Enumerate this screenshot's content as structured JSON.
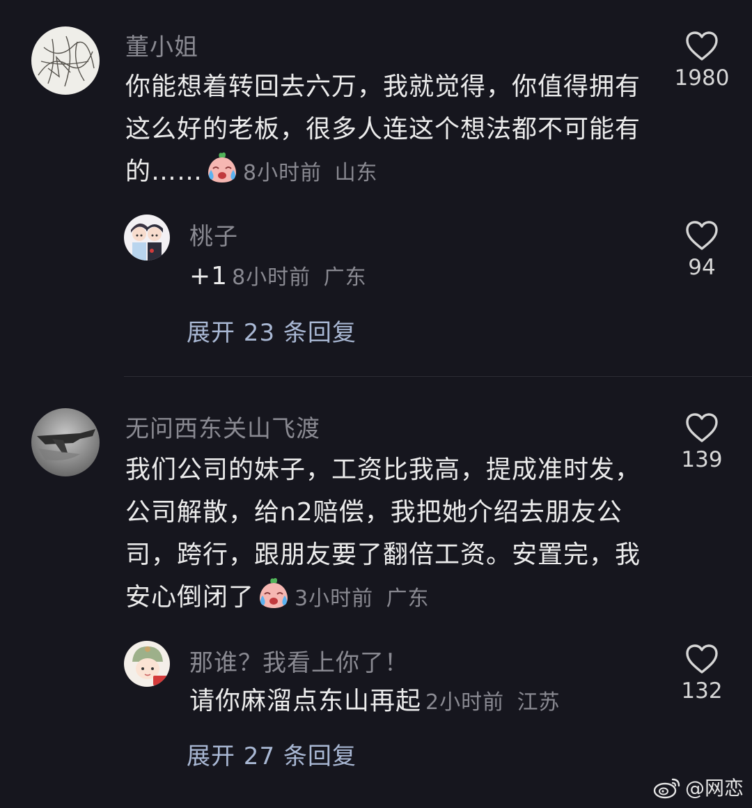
{
  "comments": [
    {
      "username": "董小姐",
      "text": "你能想着转回去六万，我就觉得，你值得拥有这么好的老板，很多人连这个想法都不可能有的……",
      "time": "8小时前",
      "location": "山东",
      "likes": "1980",
      "reply": {
        "username": "桃子",
        "text": "+1",
        "time": "8小时前",
        "location": "广东",
        "likes": "94"
      },
      "expand_label": "展开 23 条回复"
    },
    {
      "username": "无问西东关山飞渡",
      "text": "我们公司的妹子，工资比我高，提成准时发，公司解散，给n2赔偿，我把她介绍去朋友公司，跨行，跟朋友要了翻倍工资。安置完，我安心倒闭了",
      "time": "3小时前",
      "location": "广东",
      "likes": "139",
      "reply": {
        "username": "那谁？我看上你了！",
        "text": "请你麻溜点东山再起",
        "time": "2小时前",
        "location": "江苏",
        "likes": "132"
      },
      "expand_label": "展开 27 条回复"
    }
  ],
  "watermark": "@网恋",
  "icons": {
    "heart": "heart-outline-icon",
    "emoji": "crying-laughing-emoji",
    "weibo": "weibo-logo-icon"
  },
  "colors": {
    "background": "#16161e",
    "meta": "#8a8a92",
    "link": "#a9b8d4"
  }
}
